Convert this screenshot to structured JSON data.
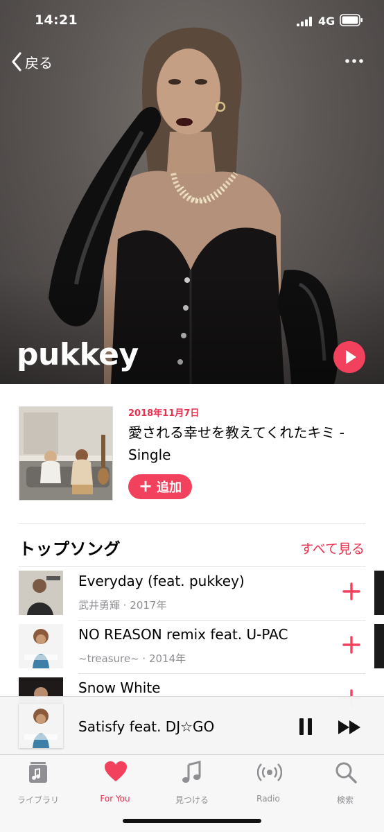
{
  "status_bar": {
    "time": "14:21",
    "network": "4G"
  },
  "nav": {
    "back_label": "戻る"
  },
  "artist": {
    "name": "pukkey"
  },
  "latest_release": {
    "date": "2018年11月7日",
    "title": "愛される幸せを教えてくれたキミ - Single",
    "add_label": "追加",
    "add_symbol": "+"
  },
  "top_songs": {
    "title": "トップソング",
    "see_all": "すべて見る",
    "items": [
      {
        "title": "Everyday (feat. pukkey)",
        "subtitle": "武井勇輝 · 2017年"
      },
      {
        "title": "NO REASON remix feat. U-PAC",
        "subtitle": "~treasure~ · 2014年"
      },
      {
        "title": "Snow White",
        "subtitle": ""
      }
    ]
  },
  "now_playing": {
    "title": "Satisfy feat. DJ☆GO"
  },
  "tabbar": {
    "items": [
      {
        "label": "ライブラリ",
        "icon": "library-icon"
      },
      {
        "label": "For You",
        "icon": "heart-icon"
      },
      {
        "label": "見つける",
        "icon": "music-note-icon"
      },
      {
        "label": "Radio",
        "icon": "radio-icon"
      },
      {
        "label": "検索",
        "icon": "search-icon"
      }
    ],
    "active": "For You"
  },
  "colors": {
    "accent": "#f2415c",
    "accent_text": "#e8304f",
    "secondary_text": "#8e8e93"
  }
}
